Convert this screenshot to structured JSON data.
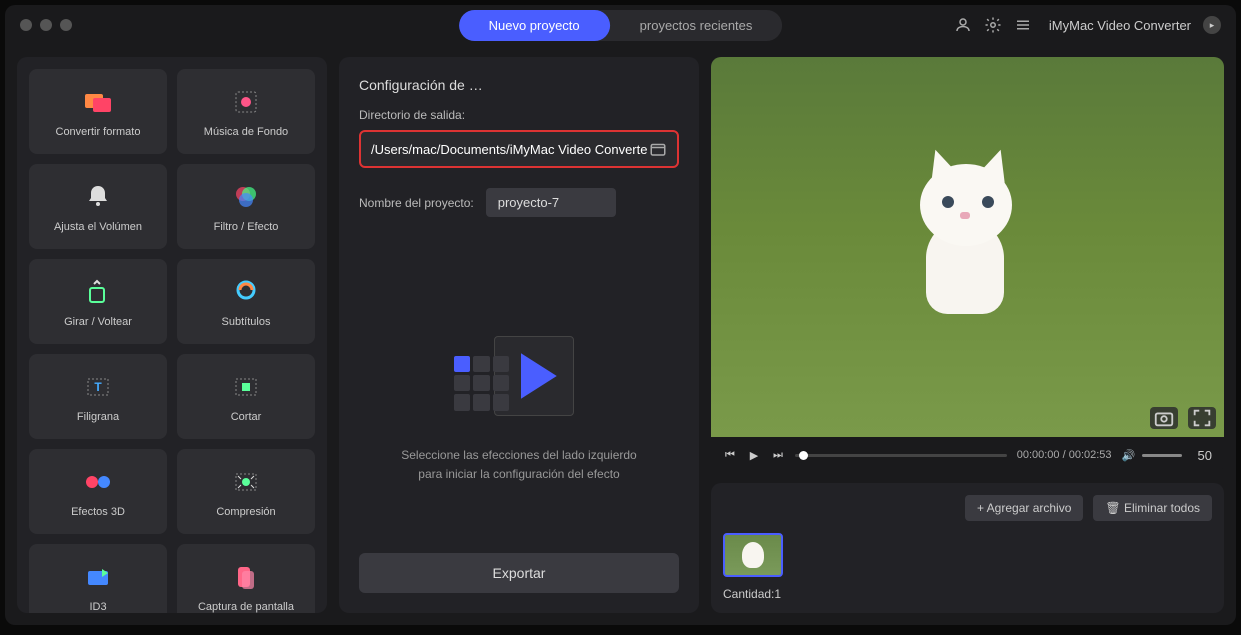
{
  "header": {
    "tab_new": "Nuevo proyecto",
    "tab_recent": "proyectos recientes",
    "app_title": "iMyMac Video Converter"
  },
  "tools": [
    {
      "label": "Convertir formato"
    },
    {
      "label": "Música de Fondo"
    },
    {
      "label": "Ajusta el Volúmen"
    },
    {
      "label": "Filtro / Efecto"
    },
    {
      "label": "Girar / Voltear"
    },
    {
      "label": "Subtítulos"
    },
    {
      "label": "Filigrana"
    },
    {
      "label": "Cortar"
    },
    {
      "label": "Efectos 3D"
    },
    {
      "label": "Compresión"
    },
    {
      "label": "ID3"
    },
    {
      "label": "Captura de pantalla"
    }
  ],
  "config": {
    "title": "Configuración de …",
    "out_label": "Directorio de salida:",
    "out_value": "/Users/mac/Documents/iMyMac Video Converte",
    "name_label": "Nombre del proyecto:",
    "name_value": "proyecto-7",
    "placeholder_text": "Seleccione las efecciones del lado izquierdo para iniciar la configuración del efecto",
    "export": "Exportar"
  },
  "player": {
    "time": "00:00:00 / 00:02:53",
    "volume": "50"
  },
  "filelist": {
    "add": "Agregar archivo",
    "remove": "Eliminar todos",
    "count_label": "Cantidad:",
    "count": "1"
  }
}
